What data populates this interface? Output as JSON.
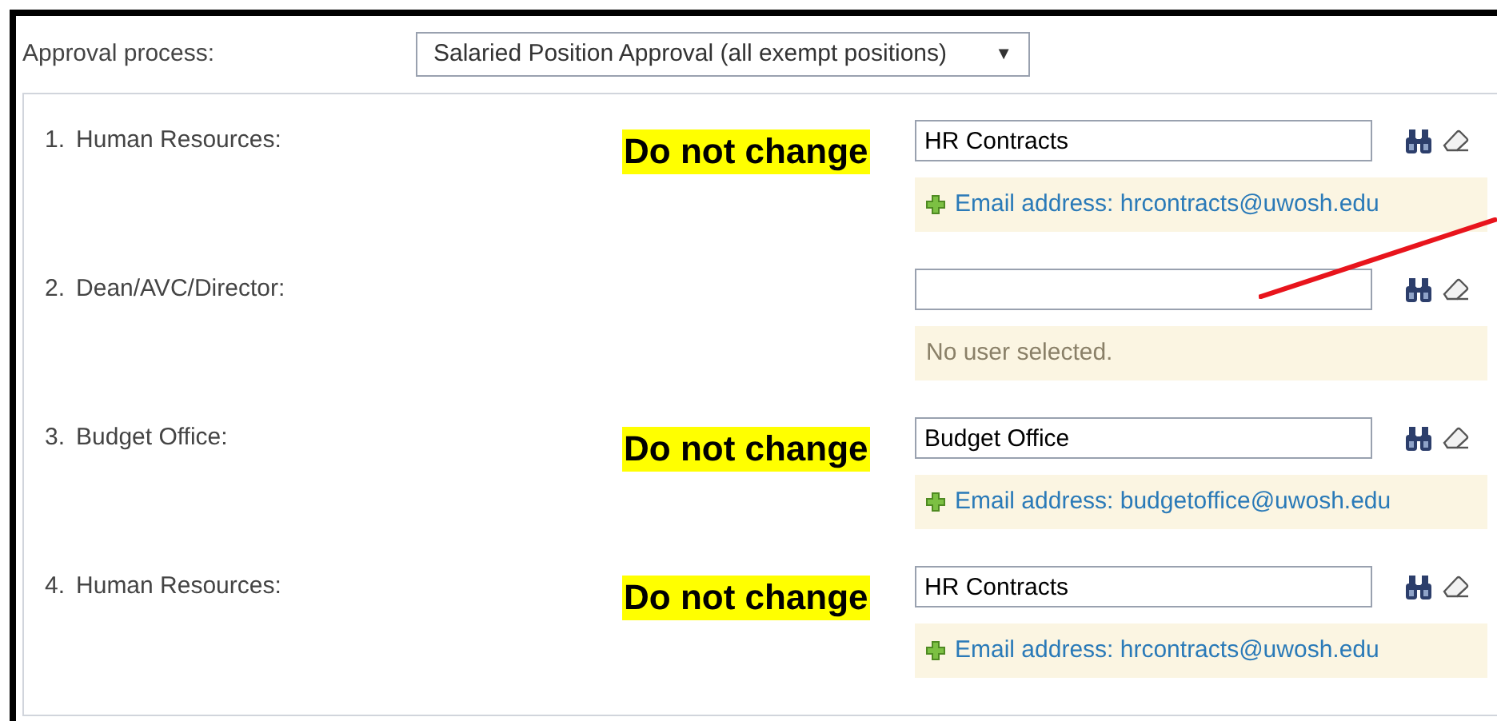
{
  "approval_process": {
    "label": "Approval process:",
    "value": "Salaried Position Approval (all exempt positions)",
    "dropdown_arrow": "▼"
  },
  "steps": [
    {
      "number": "1.",
      "role": "Human Resources:",
      "note": "Do not change",
      "user": "HR Contracts",
      "detail": {
        "kind": "email",
        "text": "Email address: hrcontracts@uwosh.edu"
      }
    },
    {
      "number": "2.",
      "role": "Dean/AVC/Director:",
      "detail": {
        "kind": "empty",
        "text": "No user selected."
      }
    },
    {
      "number": "3.",
      "role": "Budget Office:",
      "note": "Do not change",
      "user": "Budget Office",
      "detail": {
        "kind": "email",
        "text": "Email address: budgetoffice@uwosh.edu"
      }
    },
    {
      "number": "4.",
      "role": "Human Resources:",
      "note": "Do not change",
      "user": "HR Contracts",
      "detail": {
        "kind": "email",
        "text": "Email address: hrcontracts@uwosh.edu"
      }
    }
  ]
}
